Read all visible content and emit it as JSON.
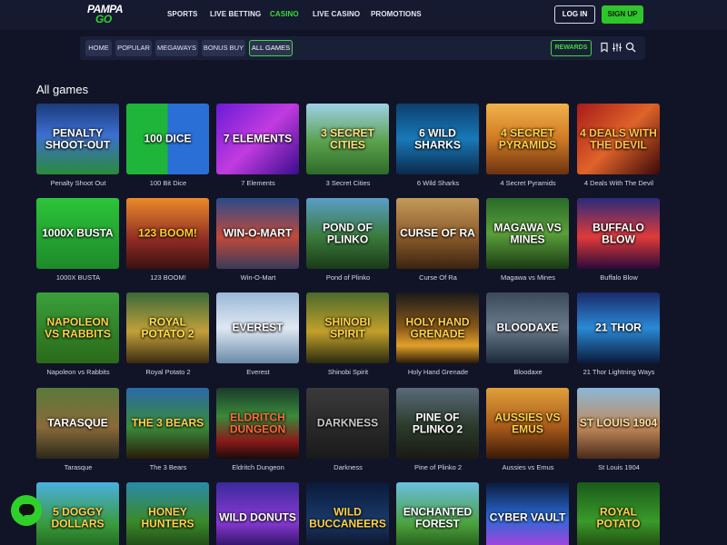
{
  "brand": {
    "line1": "PAMPA",
    "line2": "GO"
  },
  "nav": {
    "items": [
      {
        "label": "SPORTS"
      },
      {
        "label": "LIVE BETTING"
      },
      {
        "label": "CASINO",
        "active": true
      },
      {
        "label": "LIVE CASINO"
      },
      {
        "label": "PROMOTIONS"
      }
    ],
    "login_label": "LOG IN",
    "signup_label": "SIGN UP"
  },
  "filters": {
    "chips": [
      {
        "label": "HOME"
      },
      {
        "label": "POPULAR"
      },
      {
        "label": "MEGAWAYS"
      },
      {
        "label": "BONUS BUY"
      },
      {
        "label": "ALL GAMES",
        "active": true
      }
    ],
    "rewards_label": "REWARDS",
    "icons": [
      "bookmark-icon",
      "filter-icon",
      "search-icon"
    ]
  },
  "section_title": "All games",
  "games": [
    {
      "name": "Penalty Shoot Out",
      "logo": "PENALTY SHOOT-OUT"
    },
    {
      "name": "100 Bit Dice",
      "logo": "100 DICE"
    },
    {
      "name": "7 Elements",
      "logo": "7 ELEMENTS"
    },
    {
      "name": "3 Secret Cities",
      "logo": "3 SECRET CITIES"
    },
    {
      "name": "6 Wild Sharks",
      "logo": "6 WILD SHARKS"
    },
    {
      "name": "4 Secret Pyramids",
      "logo": "4 SECRET PYRAMIDS"
    },
    {
      "name": "4 Deals With The Devil",
      "logo": "4 DEALS WITH THE DEVIL"
    },
    {
      "name": "1000X BUSTA",
      "logo": "1000X BUSTA"
    },
    {
      "name": "123 BOOM!",
      "logo": "123 BOOM!"
    },
    {
      "name": "Win-O-Mart",
      "logo": "WIN-O-MART"
    },
    {
      "name": "Pond of Plinko",
      "logo": "POND OF PLINKO"
    },
    {
      "name": "Curse Of Ra",
      "logo": "CURSE OF RA"
    },
    {
      "name": "Magawa vs Mines",
      "logo": "MAGAWA VS MINES"
    },
    {
      "name": "Buffalo Blow",
      "logo": "BUFFALO BLOW"
    },
    {
      "name": "Napoleon vs Rabbits",
      "logo": "NAPOLEON VS RABBITS"
    },
    {
      "name": "Royal Potato 2",
      "logo": "ROYAL POTATO 2"
    },
    {
      "name": "Everest",
      "logo": "EVEREST"
    },
    {
      "name": "Shinobi Spirit",
      "logo": "SHINOBI SPIRIT"
    },
    {
      "name": "Holy Hand Grenade",
      "logo": "HOLY HAND GRENADE"
    },
    {
      "name": "Bloodaxe",
      "logo": "BLOODAXE"
    },
    {
      "name": "21 Thor Lightning Ways",
      "logo": "21 THOR"
    },
    {
      "name": "Tarasque",
      "logo": "TARASQUE"
    },
    {
      "name": "The 3 Bears",
      "logo": "THE 3 BEARS"
    },
    {
      "name": "Eldritch Dungeon",
      "logo": "ELDRITCH DUNGEON"
    },
    {
      "name": "Darkness",
      "logo": "DARKNESS"
    },
    {
      "name": "Pine of Plinko 2",
      "logo": "PINE OF PLINKO 2"
    },
    {
      "name": "Aussies vs Emus",
      "logo": "AUSSIES VS EMUS"
    },
    {
      "name": "St Louis 1904",
      "logo": "ST LOUIS 1904"
    },
    {
      "name": "",
      "logo": "5 DOGGY DOLLARS"
    },
    {
      "name": "",
      "logo": "HONEY HUNTERS"
    },
    {
      "name": "",
      "logo": "WILD DONUTS"
    },
    {
      "name": "",
      "logo": "WILD BUCCANEERS"
    },
    {
      "name": "",
      "logo": "ENCHANTED FOREST"
    },
    {
      "name": "",
      "logo": "CYBER VAULT"
    },
    {
      "name": "",
      "logo": "ROYAL POTATO"
    }
  ],
  "colors": {
    "accent": "#3fd93b",
    "background": "#111427",
    "header": "#151a30"
  }
}
